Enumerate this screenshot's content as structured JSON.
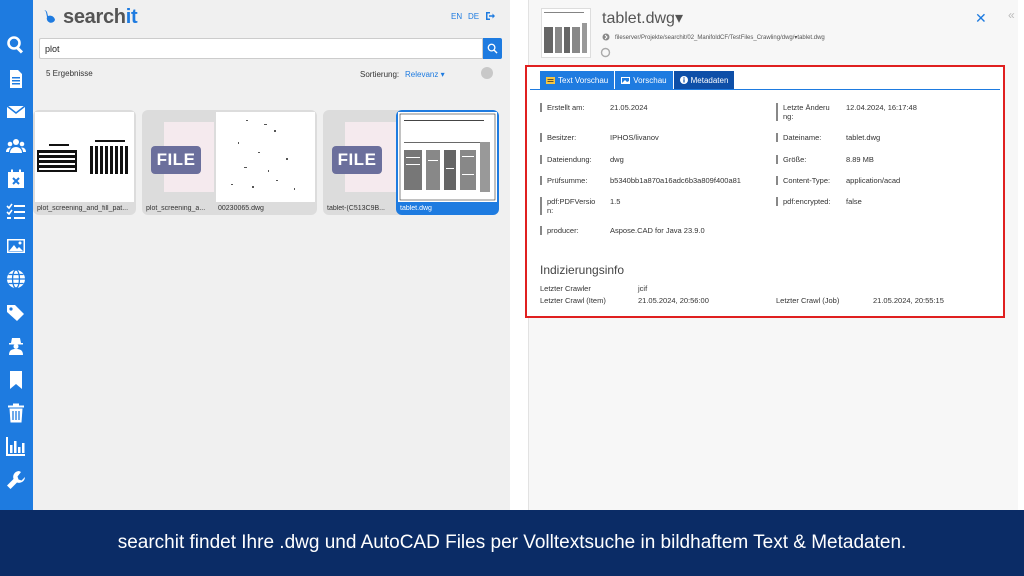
{
  "app": {
    "logo_text_a": "search",
    "logo_text_b": "it",
    "lang_en": "EN",
    "lang_de": "DE",
    "accent": "#1e7be0"
  },
  "sidebar": {
    "icons": [
      "search-icon",
      "document-icon",
      "mail-icon",
      "users-icon",
      "calendar-icon",
      "checklist-icon",
      "image-icon",
      "globe-icon",
      "tags-icon",
      "agent-icon",
      "bookmark-icon",
      "trash-icon",
      "chart-icon",
      "wrench-icon"
    ]
  },
  "search": {
    "query": "plot",
    "result_count": "5 Ergebnisse",
    "sort_label": "Sortierung:",
    "sort_value": "Relevanz ▾"
  },
  "results": [
    {
      "label": "plot_screening_and_fill_pat...",
      "kind": "drawing"
    },
    {
      "label": "plot_screening_a...",
      "kind": "file",
      "badge": "FILE"
    },
    {
      "label": "00230065.dwg",
      "kind": "drawing"
    },
    {
      "label": "tablet-(C513C9B...",
      "kind": "file",
      "badge": "FILE"
    },
    {
      "label": "tablet.dwg",
      "kind": "drawing",
      "selected": true
    }
  ],
  "detail": {
    "title": "tablet.dwg▾",
    "path": "fileserver/Projekte/searchit/02_ManifoldCF/TestFiles_Crawling/dwg/▾tablet.dwg",
    "close": "✕",
    "tabs": [
      {
        "label": "Text Vorschau"
      },
      {
        "label": "Vorschau"
      },
      {
        "label": "Metadaten",
        "active": true
      }
    ],
    "metadata": [
      {
        "key": "Erstellt am:",
        "value": "21.05.2024"
      },
      {
        "key": "Letzte Änderu ng:",
        "value": "12.04.2024, 16:17:48"
      },
      {
        "key": "Besitzer:",
        "value": "IPHOS/livanov"
      },
      {
        "key": "Dateiname:",
        "value": "tablet.dwg"
      },
      {
        "key": "Dateiendung:",
        "value": "dwg"
      },
      {
        "key": "Größe:",
        "value": "8.89 MB"
      },
      {
        "key": "Prüfsumme:",
        "value": "b5340bb1a870a16adc6b3a809f400a81"
      },
      {
        "key": "Content-Type:",
        "value": "application/acad"
      },
      {
        "key": "pdf:PDFVersio n:",
        "value": "1.5"
      },
      {
        "key": "pdf:encrypted:",
        "value": "false"
      },
      {
        "key": "producer:",
        "value": "Aspose.CAD for Java 23.9.0"
      }
    ],
    "index_section_title": "Indizierungsinfo",
    "index": {
      "crawler_label": "Letzter Crawler",
      "crawler_value": "jcif",
      "crawl_item_label": "Letzter Crawl (Item)",
      "crawl_item_value": "21.05.2024, 20:56:00",
      "crawl_job_label": "Letzter Crawl (Job)",
      "crawl_job_value": "21.05.2024, 20:55:15"
    }
  },
  "caption": "searchit findet Ihre .dwg und AutoCAD Files per Volltextsuche in bildhaftem Text & Metadaten."
}
